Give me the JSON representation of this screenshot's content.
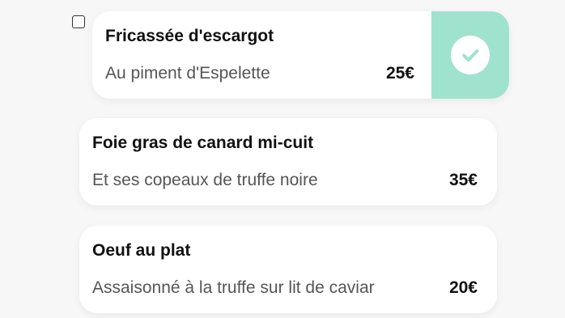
{
  "menu": {
    "items": [
      {
        "title": "Fricassée d'escargot",
        "description": "Au piment d'Espelette",
        "price": "25€",
        "selected": true
      },
      {
        "title": "Foie gras de canard mi-cuit",
        "description": "Et ses copeaux de truffe noire",
        "price": "35€",
        "selected": false
      },
      {
        "title": "Oeuf au plat",
        "description": "Assaisonné à la truffe sur lit de caviar",
        "price": "20€",
        "selected": false
      }
    ]
  },
  "colors": {
    "page_background": "#f7f7f7",
    "card_background": "#ffffff",
    "selected_accent": "#9fe3cf",
    "check_mark": "#9fe3cf"
  },
  "icons": {
    "selected_indicator": "check-circle-icon",
    "selection_box": "checkbox"
  }
}
